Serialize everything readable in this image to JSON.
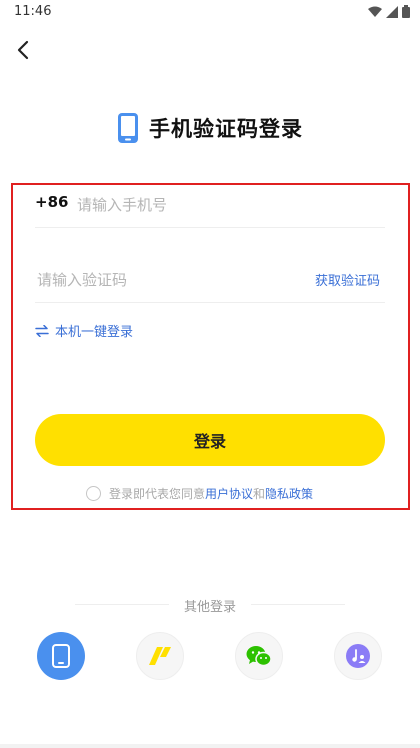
{
  "status_bar": {
    "time": "11:46"
  },
  "header": {
    "title": "手机验证码登录"
  },
  "form": {
    "country_code": "+86",
    "phone_placeholder": "请输入手机号",
    "code_placeholder": "请输入验证码",
    "get_code_label": "获取验证码",
    "onekey_label": "本机一键登录",
    "login_label": "登录",
    "agreement": {
      "prefix": "登录即代表您同意",
      "user_agreement": "用户协议",
      "and": "和",
      "privacy_policy": "隐私政策"
    }
  },
  "other_login": {
    "label": "其他登录",
    "options": [
      {
        "icon": "phone-icon",
        "color": "#4a90ee"
      },
      {
        "icon": "yellow-app-icon",
        "color": "#ffe000"
      },
      {
        "icon": "wechat-icon",
        "color": "#2dc100"
      },
      {
        "icon": "music-icon",
        "color": "#8b7cf6"
      }
    ]
  },
  "colors": {
    "accent": "#ffe000",
    "link": "#3a6fd6",
    "highlight_border": "#e02020",
    "phone_icon": "#4a90ee"
  }
}
